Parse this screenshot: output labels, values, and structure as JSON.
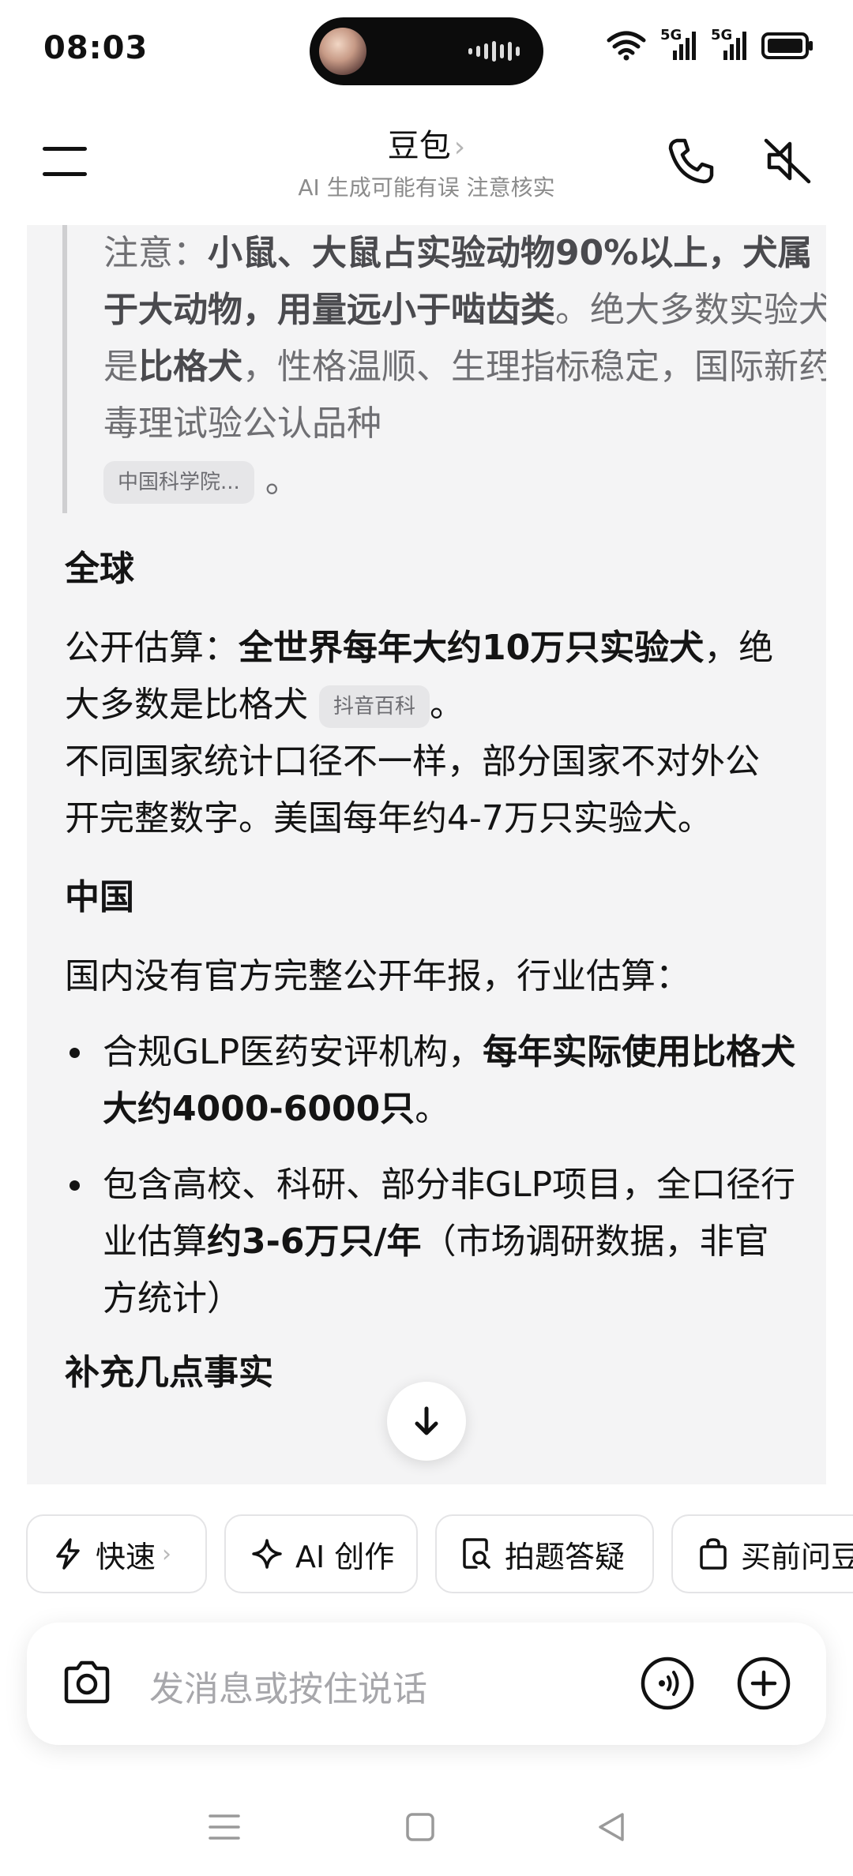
{
  "status_bar": {
    "time": "08:03",
    "network1": "5G",
    "network2": "5G"
  },
  "header": {
    "title": "豆包",
    "title_chevron": "›",
    "subtitle": "AI 生成可能有误 注意核实"
  },
  "message": {
    "quote": {
      "label": "注意：",
      "bold1": "小鼠、大鼠占实验动物90%以上，犬属于大动物，用量远小于啮齿类",
      "text1": "。绝大多数实验犬是",
      "bold2": "比格犬",
      "text2": "，性格温顺、生理指标稳定，国际新药毒理试验公认品种",
      "chip": "中国科学院...",
      "end": "。"
    },
    "global": {
      "heading": "全球",
      "p1_prefix": "公开估算：",
      "p1_bold": "全世界每年大约10万只实验犬",
      "p1_suffix": "，绝大多数是比格犬",
      "chip": "抖音百科",
      "p1_end": "。",
      "p2": "不同国家统计口径不一样，部分国家不对外公开完整数字。美国每年约4-7万只实验犬。"
    },
    "china": {
      "heading": "中国",
      "intro": "国内没有官方完整公开年报，行业估算：",
      "bullet1_prefix": "合规GLP医药安评机构，",
      "bullet1_bold": "每年实际使用比格犬大约4000-6000只",
      "bullet1_end": "。",
      "bullet2_prefix": "包含高校、科研、部分非GLP项目，全口径行业估算",
      "bullet2_bold": "约3-6万只/年",
      "bullet2_end": "（市场调研数据，非官方统计）"
    },
    "partial_heading": "补充几点事实"
  },
  "quick_actions": [
    {
      "label": "快速",
      "icon": "lightning-icon"
    },
    {
      "label": "AI 创作",
      "icon": "sparkle-icon"
    },
    {
      "label": "拍题答疑",
      "icon": "photo-search-icon"
    },
    {
      "label": "买前问豆包",
      "icon": "shopping-bag-icon"
    }
  ],
  "input": {
    "placeholder": "发消息或按住说话"
  }
}
